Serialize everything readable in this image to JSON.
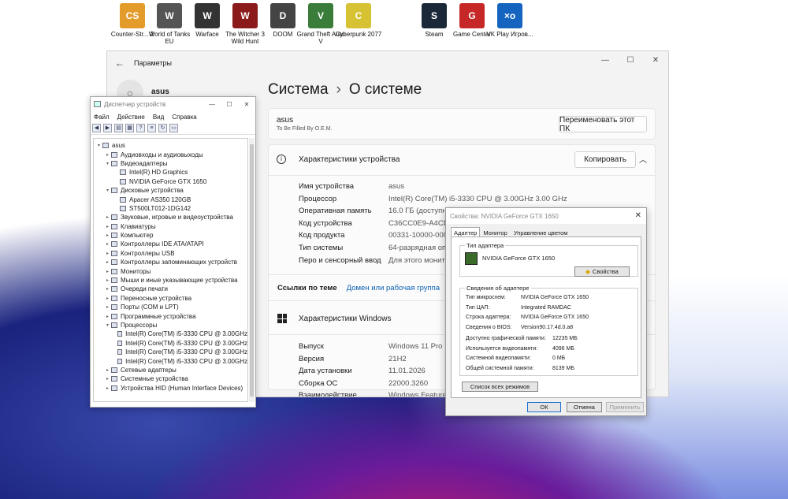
{
  "desktop": {
    "icons": [
      {
        "label": "Counter-Str... 2",
        "color": "#e39b2a",
        "glyph": "CS"
      },
      {
        "label": "World of Tanks EU",
        "color": "#555555",
        "glyph": "W"
      },
      {
        "label": "Warface",
        "color": "#333333",
        "glyph": "W"
      },
      {
        "label": "The Witcher 3 Wild Hunt",
        "color": "#8b1a1a",
        "glyph": "W"
      },
      {
        "label": "DOOM",
        "color": "#444444",
        "glyph": "D"
      },
      {
        "label": "Grand Theft Auto V",
        "color": "#3a7d3a",
        "glyph": "V"
      },
      {
        "label": "Cyberpunk 2077",
        "color": "#d6c232",
        "glyph": "C"
      },
      {
        "label": "Steam",
        "color": "#1b2838",
        "glyph": "S"
      },
      {
        "label": "Game Center",
        "color": "#c62828",
        "glyph": "G"
      },
      {
        "label": "VK Play Игров...",
        "color": "#1565c0",
        "glyph": "×o"
      }
    ]
  },
  "settings": {
    "window_title": "Параметры",
    "user": "asus",
    "crumb_parent": "Система",
    "crumb_current": "О системе",
    "pc_name": "asus",
    "pc_sub": "To Be Filled By O.E.M.",
    "rename_button": "Переименовать этот ПК",
    "device_specs_title": "Характеристики устройства",
    "copy_button": "Копировать",
    "specs": [
      {
        "label": "Имя устройства",
        "value": "asus"
      },
      {
        "label": "Процессор",
        "value": "Intel(R) Core(TM) i5-3330 CPU @ 3.00GHz   3.00 GHz"
      },
      {
        "label": "Оперативная память",
        "value": "16.0 ГБ (доступно:"
      },
      {
        "label": "Код устройства",
        "value": "C36CC0E9-A4CD-4"
      },
      {
        "label": "Код продукта",
        "value": "00331-10000-00001"
      },
      {
        "label": "Тип системы",
        "value": "64-разрядная опе"
      },
      {
        "label": "Перо и сенсорный ввод",
        "value": "Для этого монитор"
      }
    ],
    "links_label": "Ссылки по теме",
    "link_domain": "Домен или рабочая группа",
    "link_partial": "За",
    "win_specs_title": "Характеристики Windows",
    "win_specs": [
      {
        "label": "Выпуск",
        "value": "Windows 11 Pro"
      },
      {
        "label": "Версия",
        "value": "21H2"
      },
      {
        "label": "Дата установки",
        "value": "11.01.2026"
      },
      {
        "label": "Сборка ОС",
        "value": "22000.3260"
      },
      {
        "label": "Взаимодействие",
        "value": "Windows Feature E"
      }
    ]
  },
  "devmgr": {
    "title": "Диспетчер устройств",
    "menu": [
      "Файл",
      "Действие",
      "Вид",
      "Справка"
    ],
    "tree": [
      {
        "level": 0,
        "toggle": "v",
        "label": "asus"
      },
      {
        "level": 1,
        "toggle": ">",
        "label": "Аудиовходы и аудиовыходы"
      },
      {
        "level": 1,
        "toggle": "v",
        "label": "Видеоадаптеры"
      },
      {
        "level": 2,
        "toggle": "",
        "label": "Intel(R) HD Graphics"
      },
      {
        "level": 2,
        "toggle": "",
        "label": "NVIDIA GeForce GTX 1650"
      },
      {
        "level": 1,
        "toggle": "v",
        "label": "Дисковые устройства"
      },
      {
        "level": 2,
        "toggle": "",
        "label": "Apacer AS350 120GB"
      },
      {
        "level": 2,
        "toggle": "",
        "label": "ST500LT012-1DG142"
      },
      {
        "level": 1,
        "toggle": ">",
        "label": "Звуковые, игровые и видеоустройства"
      },
      {
        "level": 1,
        "toggle": ">",
        "label": "Клавиатуры"
      },
      {
        "level": 1,
        "toggle": ">",
        "label": "Компьютер"
      },
      {
        "level": 1,
        "toggle": ">",
        "label": "Контроллеры IDE ATA/ATAPI"
      },
      {
        "level": 1,
        "toggle": ">",
        "label": "Контроллеры USB"
      },
      {
        "level": 1,
        "toggle": ">",
        "label": "Контроллеры запоминающих устройств"
      },
      {
        "level": 1,
        "toggle": ">",
        "label": "Мониторы"
      },
      {
        "level": 1,
        "toggle": ">",
        "label": "Мыши и иные указывающие устройства"
      },
      {
        "level": 1,
        "toggle": ">",
        "label": "Очереди печати"
      },
      {
        "level": 1,
        "toggle": ">",
        "label": "Переносные устройства"
      },
      {
        "level": 1,
        "toggle": ">",
        "label": "Порты (COM и LPT)"
      },
      {
        "level": 1,
        "toggle": ">",
        "label": "Программные устройства"
      },
      {
        "level": 1,
        "toggle": "v",
        "label": "Процессоры"
      },
      {
        "level": 2,
        "toggle": "",
        "label": "Intel(R) Core(TM) i5-3330 CPU @ 3.00GHz"
      },
      {
        "level": 2,
        "toggle": "",
        "label": "Intel(R) Core(TM) i5-3330 CPU @ 3.00GHz"
      },
      {
        "level": 2,
        "toggle": "",
        "label": "Intel(R) Core(TM) i5-3330 CPU @ 3.00GHz"
      },
      {
        "level": 2,
        "toggle": "",
        "label": "Intel(R) Core(TM) i5-3330 CPU @ 3.00GHz"
      },
      {
        "level": 1,
        "toggle": ">",
        "label": "Сетевые адаптеры"
      },
      {
        "level": 1,
        "toggle": ">",
        "label": "Системные устройства"
      },
      {
        "level": 1,
        "toggle": ">",
        "label": "Устройства HID (Human Interface Devices)"
      }
    ]
  },
  "props": {
    "title": "Свойства: NVIDIA GeForce GTX 1650",
    "tabs": [
      "Адаптер",
      "Монитор",
      "Управление цветом"
    ],
    "adapter_type_title": "Тип адаптера",
    "adapter_name": "NVIDIA GeForce GTX 1650",
    "properties_button": "Свойства",
    "info_title": "Сведения об адаптере",
    "info": [
      {
        "label": "Тип микросхем:",
        "value": "NVIDIA GeForce GTX 1650"
      },
      {
        "label": "Тип ЦАП:",
        "value": "Integrated RAMDAC"
      },
      {
        "label": "Строка адаптера:",
        "value": "NVIDIA GeForce GTX 1650"
      },
      {
        "label": "Сведения о BIOS:",
        "value": "Version90.17.4d.0.a8"
      }
    ],
    "memory": [
      {
        "label": "Доступно графической памяти:",
        "value": "12235 МБ"
      },
      {
        "label": "Используется видеопамяти:",
        "value": "4096 МБ"
      },
      {
        "label": "Системной видеопамяти:",
        "value": "0 МБ"
      },
      {
        "label": "Общей системной памяти:",
        "value": "8139 МБ"
      }
    ],
    "modes_button": "Список всех режимов",
    "ok": "ОК",
    "cancel": "Отмена",
    "apply": "Применить"
  }
}
